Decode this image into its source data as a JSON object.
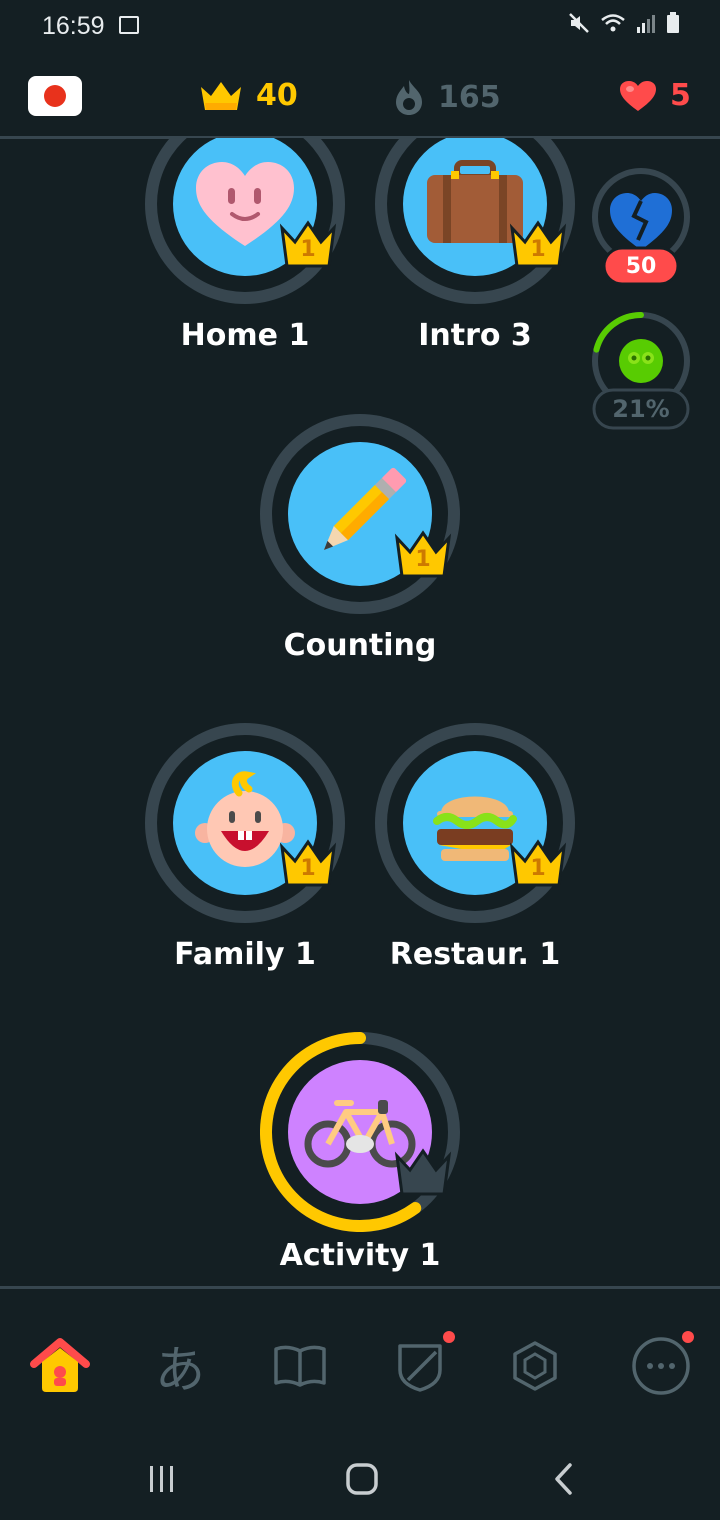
{
  "status_bar": {
    "time": "16:59"
  },
  "top_bar": {
    "language_flag": "japanese-flag",
    "crowns": "40",
    "streak": "165",
    "hearts": "5",
    "colors": {
      "crown": "#ffc800",
      "streak": "#52656d",
      "heart": "#ff4b4b"
    }
  },
  "skills": [
    {
      "label": "Home 1",
      "icon": "heart-face-icon",
      "crown_level": "1"
    },
    {
      "label": "Intro 3",
      "icon": "suitcase-icon",
      "crown_level": "1"
    },
    {
      "label": "Counting",
      "icon": "pencil-icon",
      "crown_level": "1"
    },
    {
      "label": "Family 1",
      "icon": "baby-icon",
      "crown_level": "1"
    },
    {
      "label": "Restaur. 1",
      "icon": "burger-icon",
      "crown_level": "1"
    },
    {
      "label": "Activity 1",
      "icon": "bicycle-icon",
      "crown_level": "",
      "progress": 0.6
    }
  ],
  "side_widgets": {
    "health_value": "50",
    "xp_percent_label": "21%",
    "xp_progress": 0.21
  },
  "bottom_nav": [
    {
      "name": "learn",
      "icon": "home-icon",
      "active": true
    },
    {
      "name": "characters",
      "icon": "hiragana-a-icon",
      "glyph": "あ"
    },
    {
      "name": "stories",
      "icon": "book-icon"
    },
    {
      "name": "leagues",
      "icon": "shield-icon",
      "badge": true
    },
    {
      "name": "shop",
      "icon": "gem-icon"
    },
    {
      "name": "more",
      "icon": "more-icon",
      "badge": true
    }
  ]
}
